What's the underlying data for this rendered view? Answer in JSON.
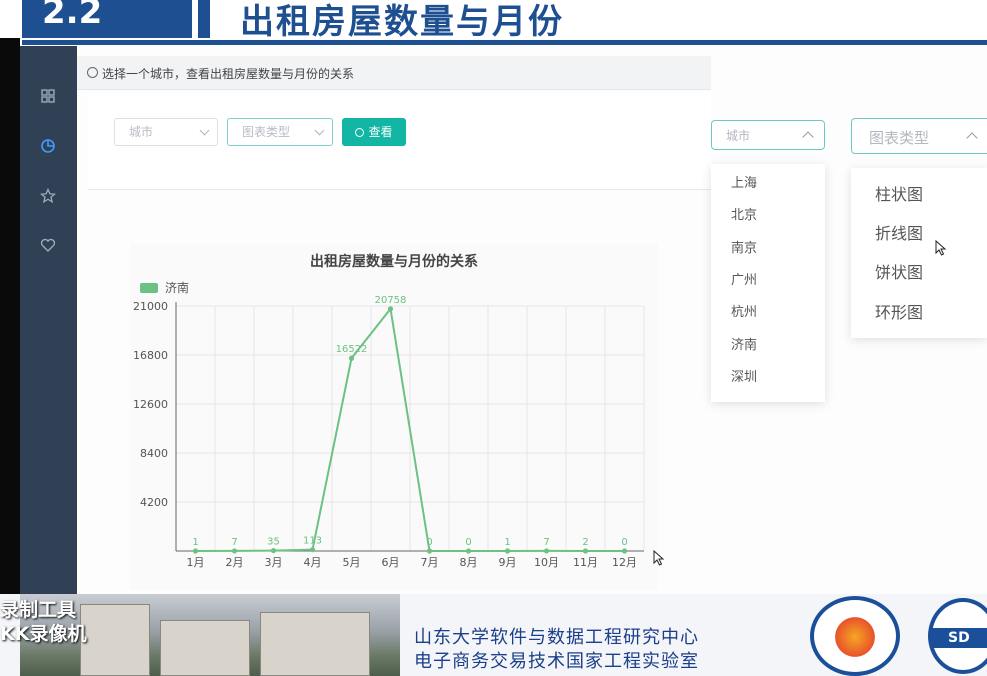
{
  "slide": {
    "section_number": "2.2",
    "title": "出租房屋数量与月份"
  },
  "breadcrumb": "选择一个城市，查看出租房屋数量与月份的关系",
  "filters": {
    "city_placeholder": "城市",
    "chart_type_placeholder": "图表类型",
    "query_button": "查看"
  },
  "city_dropdown": {
    "placeholder": "城市",
    "options": [
      "上海",
      "北京",
      "南京",
      "广州",
      "杭州",
      "济南",
      "深圳"
    ]
  },
  "chart_type_dropdown": {
    "placeholder": "图表类型",
    "options": [
      "柱状图",
      "折线图",
      "饼状图",
      "环形图"
    ]
  },
  "chart_data": {
    "type": "line",
    "title": "出租房屋数量与月份的关系",
    "categories": [
      "1月",
      "2月",
      "3月",
      "4月",
      "5月",
      "6月",
      "7月",
      "8月",
      "9月",
      "10月",
      "11月",
      "12月"
    ],
    "series": [
      {
        "name": "济南",
        "values": [
          1,
          7,
          35,
          113,
          16522,
          20758,
          0,
          0,
          1,
          7,
          2,
          0
        ]
      }
    ],
    "data_labels": [
      "1",
      "7",
      "35",
      "113",
      "16522",
      "20758",
      "0",
      "0",
      "1",
      "7",
      "2",
      "0"
    ],
    "y_ticks": [
      "4200",
      "8400",
      "12600",
      "16800",
      "21000"
    ],
    "ylim": [
      0,
      21000
    ],
    "grid": true,
    "legend_position": "top-left",
    "series_color": "#6cc183"
  },
  "watermark": [
    "录制工具",
    "KK录像机"
  ],
  "lab": {
    "line1": "山东大学软件与数据工程研究中心",
    "line2": "电子商务交易技术国家工程实验室"
  },
  "logo_text": "SD"
}
